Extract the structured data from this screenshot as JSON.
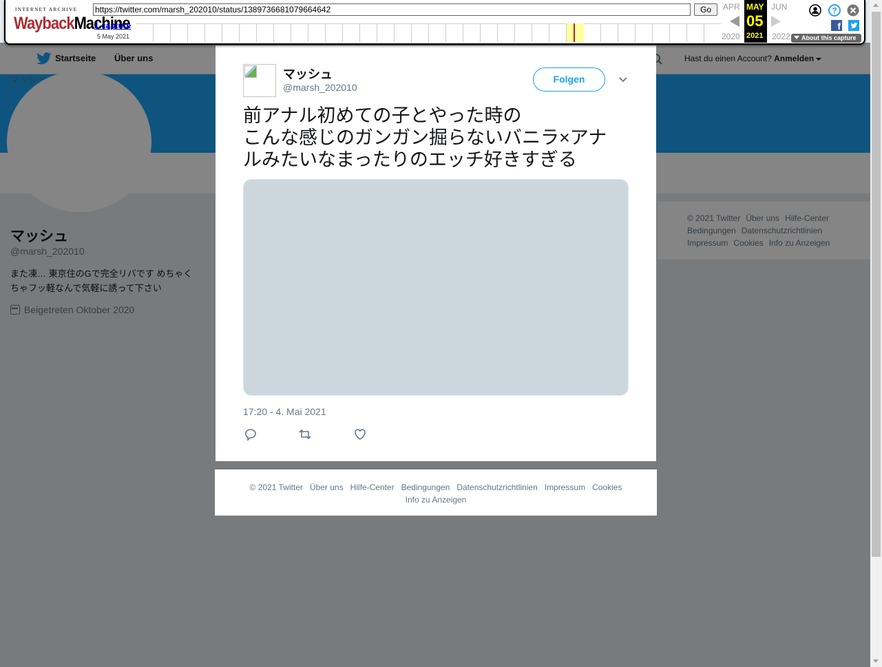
{
  "wayback": {
    "logo_top": "INTERNET ARCHIVE",
    "logo_way": "Wayback",
    "logo_machine": "Machine",
    "url": "https://twitter.com/marsh_202010/status/1389736681079664642",
    "go_label": "Go",
    "captures_label": "1 capture",
    "capture_date": "5 May 2021",
    "prev_month": "APR",
    "current_month": "MAY",
    "next_month": "JUN",
    "prev_year": "2020",
    "current_day": "05",
    "current_year": "2021",
    "next_year": "2022",
    "about_label": "About this capture",
    "highlight_color": "#ffff00",
    "brand_red": "#ab2e33"
  },
  "nav": {
    "home_label": "Startseite",
    "about_label": "Über uns",
    "account_prompt": "Hast du einen Account?",
    "login_label": "Anmelden"
  },
  "profile": {
    "banner_alt": "マッシュ",
    "name": "マッシュ",
    "handle": "@marsh_202010",
    "bio": "また凍… 東京住のGで完全リバです めちゃくちゃフッ軽なんで気軽に誘って下さい",
    "joined": "Beigetreten Oktober 2020"
  },
  "side_footer": {
    "links": [
      "© 2021 Twitter",
      "Über uns",
      "Hilfe-Center",
      "Bedingungen",
      "Datenschutzrichtlinien",
      "Impressum",
      "Cookies",
      "Info zu Anzeigen"
    ]
  },
  "tweet": {
    "name": "マッシュ",
    "handle": "@marsh_202010",
    "follow_label": "Folgen",
    "text_line1": "前アナル初めての子とやった時の",
    "text_line2": "こんな感じのガンガン掘らないバニラ×アナ",
    "text_line3": "ルみたいなまったりのエッチ好きすぎる",
    "timestamp": "17:20 - 4. Mai 2021",
    "accent_color": "#1da1f2"
  },
  "modal_footer": {
    "links": [
      "© 2021 Twitter",
      "Über uns",
      "Hilfe-Center",
      "Bedingungen",
      "Datenschutzrichtlinien",
      "Impressum",
      "Cookies",
      "Info zu Anzeigen"
    ]
  },
  "icons": [
    "twitter-bird-icon",
    "search-icon",
    "calendar-icon",
    "chevron-down-icon",
    "reply-icon",
    "retweet-icon",
    "like-icon",
    "user-icon",
    "help-icon",
    "close-icon",
    "facebook-icon",
    "twitter-share-icon"
  ]
}
